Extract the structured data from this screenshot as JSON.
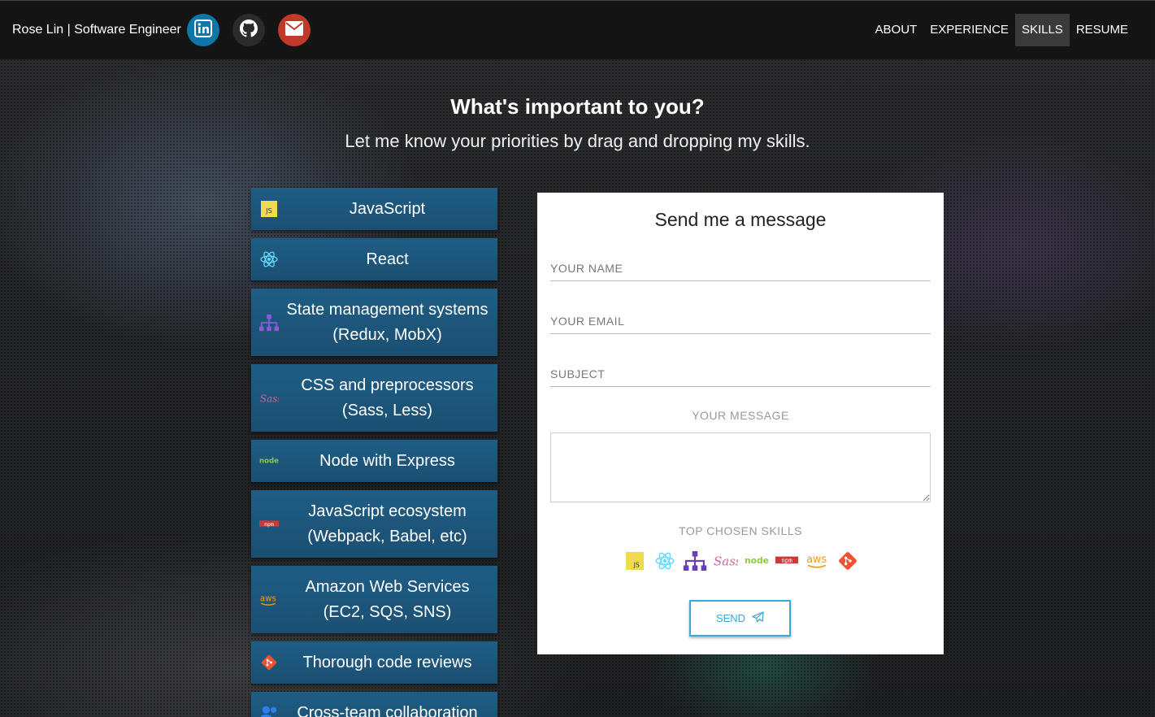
{
  "navbar": {
    "brand": "Rose Lin | Software Engineer",
    "social": [
      {
        "name": "linkedin",
        "icon": "linkedin-icon",
        "color": "#0e76a8"
      },
      {
        "name": "github",
        "icon": "github-icon",
        "color": "#2b2b2b"
      },
      {
        "name": "email",
        "icon": "envelope-icon",
        "color": "#c0392b"
      }
    ],
    "links": [
      "ABOUT",
      "EXPERIENCE",
      "SKILLS",
      "RESUME"
    ],
    "active": "SKILLS"
  },
  "heading": {
    "title": "What's important to you?",
    "subtitle": "Let me know your priorities by drag and dropping my skills."
  },
  "skills": [
    {
      "label": "JavaScript",
      "icon": "js-icon"
    },
    {
      "label": "React",
      "icon": "react-icon"
    },
    {
      "label": "State management systems\n(Redux, MobX)",
      "icon": "sitemap-icon"
    },
    {
      "label": "CSS and preprocessors\n(Sass, Less)",
      "icon": "sass-icon"
    },
    {
      "label": "Node with Express",
      "icon": "node-icon"
    },
    {
      "label": "JavaScript ecosystem\n(Webpack, Babel, etc)",
      "icon": "npm-icon"
    },
    {
      "label": "Amazon Web Services\n(EC2, SQS, SNS)",
      "icon": "aws-icon"
    },
    {
      "label": "Thorough code reviews",
      "icon": "git-icon"
    },
    {
      "label": "Cross-team collaboration",
      "icon": "users-icon"
    }
  ],
  "form": {
    "title": "Send me a message",
    "name_placeholder": "YOUR NAME",
    "email_placeholder": "YOUR EMAIL",
    "subject_placeholder": "SUBJECT",
    "message_label": "YOUR MESSAGE",
    "top_skills_label": "TOP CHOSEN SKILLS",
    "top_skills_icons": [
      "js-icon",
      "react-icon",
      "sitemap-icon",
      "sass-icon",
      "node-icon",
      "npm-icon",
      "aws-icon",
      "git-icon"
    ],
    "send_label": "SEND",
    "accent_color": "#3ba8d8"
  }
}
